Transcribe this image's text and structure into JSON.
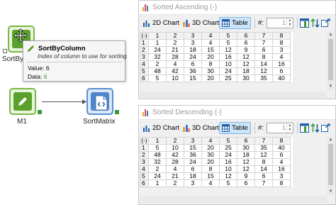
{
  "graph": {
    "nodes": {
      "sort_by_column": {
        "label": "SortByCo"
      },
      "m1": {
        "label": "M1"
      },
      "sort_matrix": {
        "label": "SortMatrix"
      }
    },
    "tooltip": {
      "title": "SortByColumn",
      "description": "Index of column to use for sorting",
      "value_label": "Value:",
      "value": "6",
      "data_label": "Data:",
      "data": "6"
    }
  },
  "colors": {
    "node_green": "#5aa12b",
    "node_blue": "#4f86cf",
    "active_button": "#cde4f7",
    "port_green": "#3a9a3a"
  },
  "viewers": [
    {
      "title": "Sorted Ascending (-)",
      "toolbar": {
        "chart2d": "2D Chart",
        "chart3d": "3D Chart",
        "table": "Table",
        "hash": "#:",
        "spin_value": "1"
      },
      "header": [
        "(-)",
        "1",
        "2",
        "3",
        "4",
        "5",
        "6",
        "7",
        "8"
      ],
      "rows": [
        [
          "1",
          "1",
          "2",
          "3",
          "4",
          "5",
          "6",
          "7",
          "8"
        ],
        [
          "2",
          "24",
          "21",
          "18",
          "15",
          "12",
          "9",
          "6",
          "3"
        ],
        [
          "3",
          "32",
          "28",
          "24",
          "20",
          "16",
          "12",
          "8",
          "4"
        ],
        [
          "4",
          "2",
          "4",
          "6",
          "8",
          "10",
          "12",
          "14",
          "16"
        ],
        [
          "5",
          "48",
          "42",
          "36",
          "30",
          "24",
          "18",
          "12",
          "6"
        ],
        [
          "6",
          "5",
          "10",
          "15",
          "20",
          "25",
          "30",
          "35",
          "40"
        ]
      ]
    },
    {
      "title": "Sorted Descending (-)",
      "toolbar": {
        "chart2d": "2D Chart",
        "chart3d": "3D Chart",
        "table": "Table",
        "hash": "#:",
        "spin_value": "1"
      },
      "header": [
        "(-)",
        "1",
        "2",
        "3",
        "4",
        "5",
        "6",
        "7",
        "8"
      ],
      "rows": [
        [
          "1",
          "5",
          "10",
          "15",
          "20",
          "25",
          "30",
          "35",
          "40"
        ],
        [
          "2",
          "48",
          "42",
          "36",
          "30",
          "24",
          "18",
          "12",
          "6"
        ],
        [
          "3",
          "32",
          "28",
          "24",
          "20",
          "16",
          "12",
          "8",
          "4"
        ],
        [
          "4",
          "2",
          "4",
          "6",
          "8",
          "10",
          "12",
          "14",
          "16"
        ],
        [
          "5",
          "24",
          "21",
          "18",
          "15",
          "12",
          "9",
          "6",
          "3"
        ],
        [
          "6",
          "1",
          "2",
          "3",
          "4",
          "5",
          "6",
          "7",
          "8"
        ]
      ]
    }
  ]
}
